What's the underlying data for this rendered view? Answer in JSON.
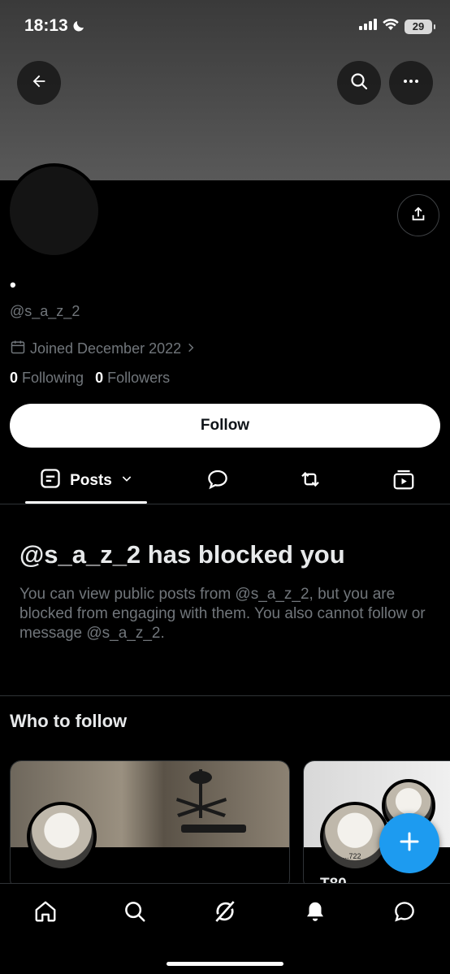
{
  "status_bar": {
    "time": "18:13",
    "battery": "29"
  },
  "profile": {
    "display_name": "•",
    "handle": "@s_a_z_2",
    "joined": "Joined December 2022",
    "following_count": "0",
    "following_label": "Following",
    "followers_count": "0",
    "followers_label": "Followers"
  },
  "follow_button": {
    "label": "Follow"
  },
  "tabs": {
    "posts_label": "Posts"
  },
  "blocked": {
    "title": "@s_a_z_2 has blocked you",
    "message": "You can view public posts from @s_a_z_2, but you are blocked from engaging with them. You also cannot follow or message @s_a_z_2."
  },
  "who_to_follow": {
    "title": "Who to follow",
    "cards": [
      {
        "name": "",
        "button": ""
      },
      {
        "name": "T80"
      }
    ],
    "avatar_caption": "...722"
  },
  "colors": {
    "accent": "#1d9bf0",
    "background": "#000000",
    "muted_text": "#71767b"
  },
  "icons": [
    "back-arrow-icon",
    "search-icon",
    "more-icon",
    "share-icon",
    "calendar-icon",
    "chevron-right-icon",
    "posts-icon",
    "chevron-down-icon",
    "reply-icon",
    "repost-icon",
    "media-icon",
    "plus-icon",
    "home-icon",
    "grok-icon",
    "bell-icon",
    "messages-icon"
  ]
}
